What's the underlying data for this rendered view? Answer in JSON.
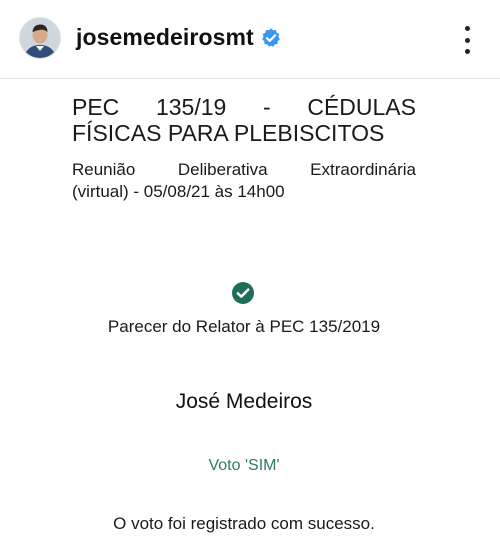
{
  "header": {
    "username": "josemedeirosmt",
    "verified_icon": "verified-badge-icon",
    "more_icon": "more-vertical-icon",
    "verified_color": "#3897f0"
  },
  "post": {
    "title_line1_parts": [
      "PEC",
      "135/19",
      "-",
      "CÉDULAS"
    ],
    "title_line2": "FÍSICAS PARA PLEBISCITOS",
    "subtitle_line1_parts": [
      "Reunião",
      "Deliberativa",
      "Extraordinária"
    ],
    "subtitle_line2": "(virtual) - 05/08/21 às 14h00",
    "check_icon": "check-circle-icon",
    "check_color": "#1f6e57",
    "parecer": "Parecer do Relator à PEC 135/2019",
    "name": "José Medeiros",
    "voto": "Voto 'SIM'",
    "voto_color": "#2d7c63",
    "success": "O voto foi registrado com sucesso."
  }
}
